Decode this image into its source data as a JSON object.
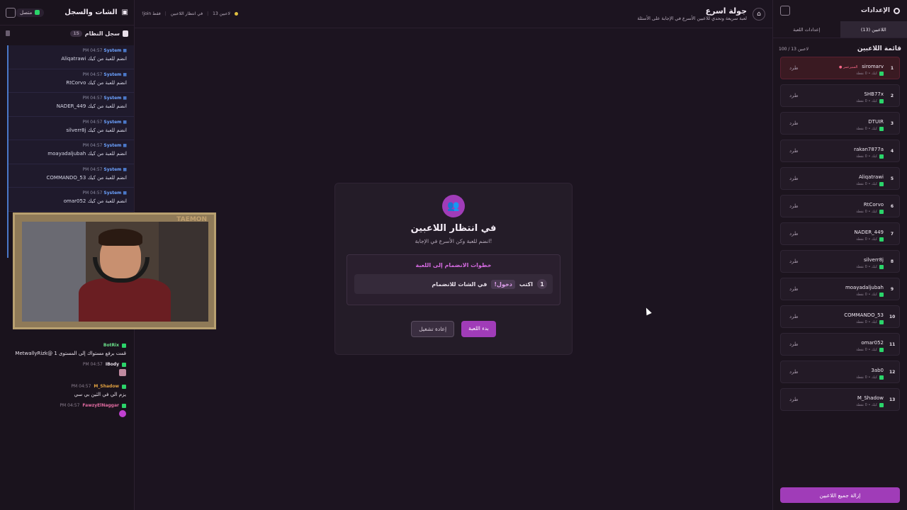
{
  "left": {
    "title": "الشات والسجل",
    "status": "متصل",
    "log_title": "سجل النظام",
    "log_count": "15",
    "log": [
      {
        "time": "PM 04:57",
        "sender": "System",
        "text": "Aliqatrawi انضم للعبة من كيك"
      },
      {
        "time": "PM 04:57",
        "sender": "System",
        "text": "RtCorvo انضم للعبة من كيك"
      },
      {
        "time": "PM 04:57",
        "sender": "System",
        "text": "NADER_449 انضم للعبة من كيك"
      },
      {
        "time": "PM 04:57",
        "sender": "System",
        "text": "silverr8j انضم للعبة من كيك"
      },
      {
        "time": "PM 04:57",
        "sender": "System",
        "text": "moayadaljubah انضم للعبة من كيك"
      },
      {
        "time": "PM 04:57",
        "sender": "System",
        "text": "COMMANDO_53 انضم للعبة من كيك"
      },
      {
        "time": "PM 04:57",
        "sender": "System",
        "text": "omar052 انضم للعبة من كيك"
      }
    ],
    "webcam_logo": "TAEMON",
    "chat": [
      {
        "time": "",
        "user": "BotRix",
        "color": "#6ae08a",
        "text": "MetwallyRizk@ قمت برفع مستواك إلى المستوى 1"
      },
      {
        "time": "PM 04:57",
        "user": "IBody",
        "color": "#e8e0ea",
        "text": ""
      },
      {
        "time": "PM 04:57",
        "user": "M_Shadow",
        "color": "#e0a040",
        "text": "يزم الي في الثين بي سي"
      },
      {
        "time": "PM 04:57",
        "user": "FawzyElNaggar",
        "color": "#e06aa0",
        "text": ""
      }
    ]
  },
  "top": {
    "title": "جولة اسرع",
    "subtitle": "لعبة سريعة وتحدي للاعبين الأسرع في الإجابة على الأسئلة",
    "status_players": "13 لاعبين",
    "status_waiting": "في انتظار اللاعبين",
    "status_hint": "!join فقط"
  },
  "modal": {
    "title": "في انتظار اللاعبين",
    "subtitle": "انضم للعبة وكن الأسرع في الإجابة!",
    "steps_title": "خطوات الانضمام إلى اللعبة",
    "step_num": "1",
    "step_pre": "اكتب",
    "step_cmd": "!دخول",
    "step_post": "في الشات للانضمام",
    "restart": "إعادة تشغيل",
    "start": "بدء اللعبة"
  },
  "right": {
    "title": "الإعدادات",
    "tab_players": "اللاعبين (13)",
    "tab_game": "إعدادات اللعبة",
    "list_title": "قائمة اللاعبين",
    "count": "100 / 13 لاعبين",
    "kick": "طرد",
    "stats": "كيك • 0 نقطة",
    "sultan_tag": "● السيرعمر",
    "players": [
      "siromarv",
      "SHB77x",
      "DTUIR",
      "rakan7877a",
      "Aliqatrawi",
      "RtCorvo",
      "NADER_449",
      "silverr8j",
      "moayadaljubah",
      "COMMANDO_53",
      "omar052",
      "3ab0",
      "M_Shadow"
    ],
    "remove_all": "إزالة جميع اللاعبين"
  }
}
